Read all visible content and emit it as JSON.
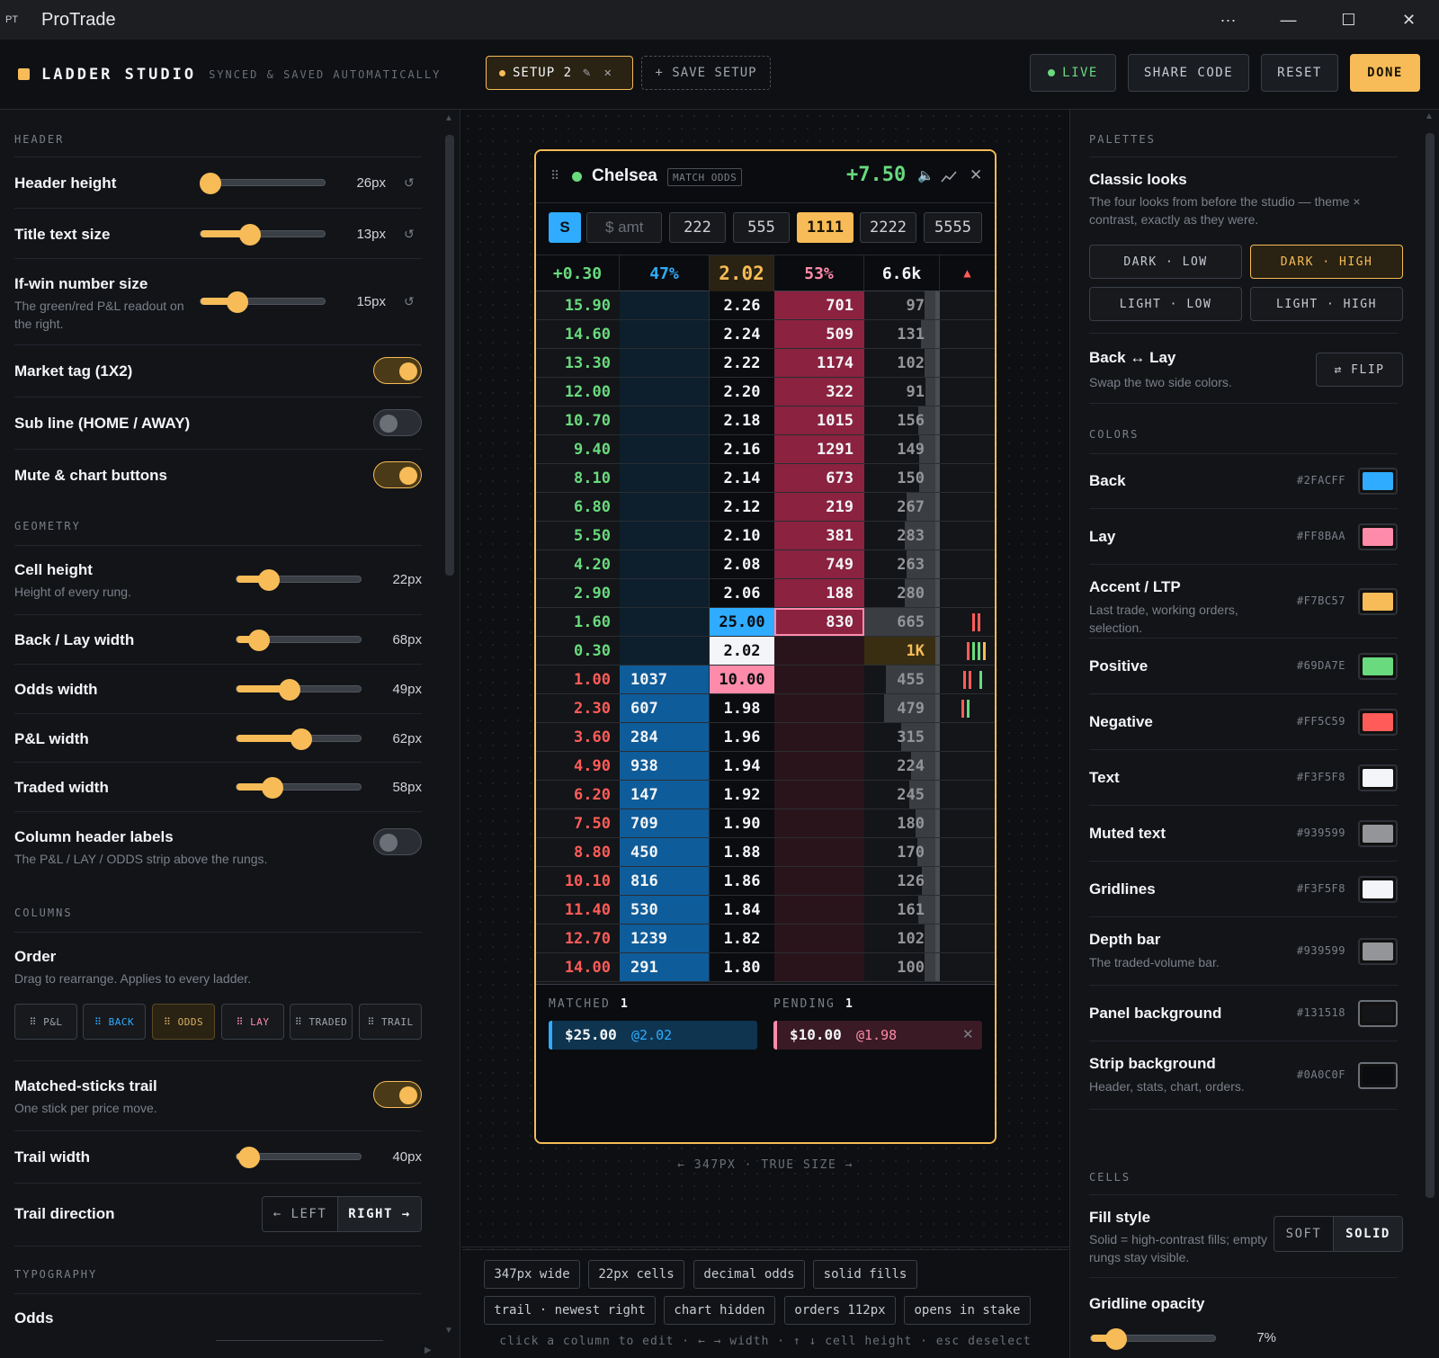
{
  "window": {
    "icon": "PT",
    "title": "ProTrade",
    "more": "···",
    "minimize": "—",
    "maximize": "☐",
    "close": "✕"
  },
  "header": {
    "brand": "LADDER STUDIO",
    "brand_sub": "SYNCED & SAVED AUTOMATICALLY",
    "setup_tab": "SETUP 2",
    "save_setup": "+ SAVE SETUP",
    "live": "LIVE",
    "share": "SHARE CODE",
    "reset": "RESET",
    "done": "DONE"
  },
  "left": {
    "header_section": "HEADER",
    "header_height": {
      "label": "Header height",
      "value": "26px",
      "level": 0.08
    },
    "title_text_size": {
      "label": "Title text size",
      "value": "13px",
      "level": 0.4
    },
    "ifwin_size": {
      "label": "If-win number size",
      "sub": "The green/red P&L readout on the right.",
      "value": "15px",
      "level": 0.3
    },
    "market_tag": {
      "label": "Market tag (1X2)",
      "on": true
    },
    "sub_line": {
      "label": "Sub line (HOME / AWAY)",
      "on": false
    },
    "mute_chart": {
      "label": "Mute & chart buttons",
      "on": true
    },
    "geometry_section": "GEOMETRY",
    "cell_height": {
      "label": "Cell height",
      "sub": "Height of every rung.",
      "value": "22px",
      "level": 0.26
    },
    "backlay_width": {
      "label": "Back / Lay width",
      "value": "68px",
      "level": 0.18
    },
    "odds_width": {
      "label": "Odds width",
      "value": "49px",
      "level": 0.43
    },
    "pl_width": {
      "label": "P&L width",
      "value": "62px",
      "level": 0.52
    },
    "traded_width": {
      "label": "Traded width",
      "value": "58px",
      "level": 0.29
    },
    "col_header_labels": {
      "label": "Column header labels",
      "sub": "The P&L / LAY / ODDS strip above the rungs.",
      "on": false
    },
    "columns_section": "COLUMNS",
    "order": {
      "label": "Order",
      "sub": "Drag to rearrange. Applies to every ladder.",
      "chips": [
        "⠿ P&L",
        "⠿ BACK",
        "⠿ ODDS",
        "⠿ LAY",
        "⠿ TRADED",
        "⠿ TRAIL"
      ]
    },
    "matched_trail": {
      "label": "Matched-sticks trail",
      "sub": "One stick per price move.",
      "on": true
    },
    "trail_width": {
      "label": "Trail width",
      "value": "40px",
      "level": 0.1
    },
    "trail_direction": {
      "label": "Trail direction",
      "left": "← LEFT",
      "right": "RIGHT →"
    },
    "typography_section": "TYPOGRAPHY",
    "odds_label": "Odds",
    "reset_icon": "↺"
  },
  "ladder": {
    "title": "Chelsea",
    "tag": "MATCH ODDS",
    "pnl": "+7.50",
    "stake_toggle": "S",
    "amt_placeholder": "$ amt",
    "stakes": [
      "222",
      "555",
      "1111",
      "2222",
      "5555"
    ],
    "stats": {
      "pl": "+0.30",
      "back_pct": "47%",
      "ltp": "2.02",
      "lay_pct": "53%",
      "vol": "6.6k",
      "arrow": "▲"
    },
    "rungs": [
      {
        "pl": "15.90",
        "back": "",
        "odds": "2.26",
        "lay": "701",
        "traded": "97"
      },
      {
        "pl": "14.60",
        "back": "",
        "odds": "2.24",
        "lay": "509",
        "traded": "131"
      },
      {
        "pl": "13.30",
        "back": "",
        "odds": "2.22",
        "lay": "1174",
        "traded": "102"
      },
      {
        "pl": "12.00",
        "back": "",
        "odds": "2.20",
        "lay": "322",
        "traded": "91"
      },
      {
        "pl": "10.70",
        "back": "",
        "odds": "2.18",
        "lay": "1015",
        "traded": "156"
      },
      {
        "pl": "9.40",
        "back": "",
        "odds": "2.16",
        "lay": "1291",
        "traded": "149"
      },
      {
        "pl": "8.10",
        "back": "",
        "odds": "2.14",
        "lay": "673",
        "traded": "150"
      },
      {
        "pl": "6.80",
        "back": "",
        "odds": "2.12",
        "lay": "219",
        "traded": "267"
      },
      {
        "pl": "5.50",
        "back": "",
        "odds": "2.10",
        "lay": "381",
        "traded": "283"
      },
      {
        "pl": "4.20",
        "back": "",
        "odds": "2.08",
        "lay": "749",
        "traded": "263"
      },
      {
        "pl": "2.90",
        "back": "",
        "odds": "2.06",
        "lay": "188",
        "traded": "280"
      },
      {
        "pl": "1.60",
        "back": "",
        "odds": "25.00",
        "lay": "830",
        "traded": "665"
      },
      {
        "pl": "0.30",
        "back": "",
        "odds": "2.02",
        "lay": "",
        "traded": "1K"
      },
      {
        "pl": "1.00",
        "back": "1037",
        "odds": "10.00",
        "lay": "",
        "traded": "455"
      },
      {
        "pl": "2.30",
        "back": "607",
        "odds": "1.98",
        "lay": "",
        "traded": "479"
      },
      {
        "pl": "3.60",
        "back": "284",
        "odds": "1.96",
        "lay": "",
        "traded": "315"
      },
      {
        "pl": "4.90",
        "back": "938",
        "odds": "1.94",
        "lay": "",
        "traded": "224"
      },
      {
        "pl": "6.20",
        "back": "147",
        "odds": "1.92",
        "lay": "",
        "traded": "245"
      },
      {
        "pl": "7.50",
        "back": "709",
        "odds": "1.90",
        "lay": "",
        "traded": "180"
      },
      {
        "pl": "8.80",
        "back": "450",
        "odds": "1.88",
        "lay": "",
        "traded": "170"
      },
      {
        "pl": "10.10",
        "back": "816",
        "odds": "1.86",
        "lay": "",
        "traded": "126"
      },
      {
        "pl": "11.40",
        "back": "530",
        "odds": "1.84",
        "lay": "",
        "traded": "161"
      },
      {
        "pl": "12.70",
        "back": "1239",
        "odds": "1.82",
        "lay": "",
        "traded": "102"
      },
      {
        "pl": "14.00",
        "back": "291",
        "odds": "1.80",
        "lay": "",
        "traded": "100"
      }
    ],
    "matched_label": "MATCHED",
    "matched_count": "1",
    "pending_label": "PENDING",
    "pending_count": "1",
    "matched_order": {
      "amount": "$25.00",
      "price": "@2.02"
    },
    "pending_order": {
      "amount": "$10.00",
      "price": "@1.98"
    },
    "size_caption": "← 347PX · TRUE SIZE →"
  },
  "summary_pills": [
    "347px wide",
    "22px cells",
    "decimal odds",
    "solid fills",
    "trail · newest right",
    "chart hidden",
    "orders 112px",
    "opens in stake"
  ],
  "hint": "click a column to edit · ← → width · ↑ ↓ cell height · esc deselect",
  "right": {
    "palettes_section": "PALETTES",
    "classic_title": "Classic looks",
    "classic_sub": "The four looks from before the studio — theme × contrast, exactly as they were.",
    "looks": [
      "DARK · LOW",
      "DARK · HIGH",
      "LIGHT · LOW",
      "LIGHT · HIGH"
    ],
    "backlay_title": "Back ↔ Lay",
    "backlay_sub": "Swap the two side colors.",
    "flip": "⇄ FLIP",
    "colors_section": "COLORS",
    "colors": [
      {
        "label": "Back",
        "sub": "",
        "hex": "#2FACFF",
        "color": "#2FACFF"
      },
      {
        "label": "Lay",
        "sub": "",
        "hex": "#FF8BAA",
        "color": "#FF8BAA"
      },
      {
        "label": "Accent / LTP",
        "sub": "Last trade, working orders, selection.",
        "hex": "#F7BC57",
        "color": "#F7BC57"
      },
      {
        "label": "Positive",
        "sub": "",
        "hex": "#69DA7E",
        "color": "#69DA7E"
      },
      {
        "label": "Negative",
        "sub": "",
        "hex": "#FF5C59",
        "color": "#FF5C59"
      },
      {
        "label": "Text",
        "sub": "",
        "hex": "#F3F5F8",
        "color": "#F3F5F8"
      },
      {
        "label": "Muted text",
        "sub": "",
        "hex": "#939599",
        "color": "#939599"
      },
      {
        "label": "Gridlines",
        "sub": "",
        "hex": "#F3F5F8",
        "color": "#F3F5F8"
      },
      {
        "label": "Depth bar",
        "sub": "The traded-volume bar.",
        "hex": "#939599",
        "color": "#939599"
      },
      {
        "label": "Panel background",
        "sub": "",
        "hex": "#131518",
        "color": "#131518"
      },
      {
        "label": "Strip background",
        "sub": "Header, stats, chart, orders.",
        "hex": "#0A0C0F",
        "color": "#0A0C0F"
      }
    ],
    "cells_section": "CELLS",
    "fill_title": "Fill style",
    "fill_sub": "Solid = high-contrast fills; empty rungs stay visible.",
    "fill_soft": "SOFT",
    "fill_solid": "SOLID",
    "gridline_title": "Gridline opacity",
    "gridline_value": "7%",
    "gridline_level": 0.2
  }
}
